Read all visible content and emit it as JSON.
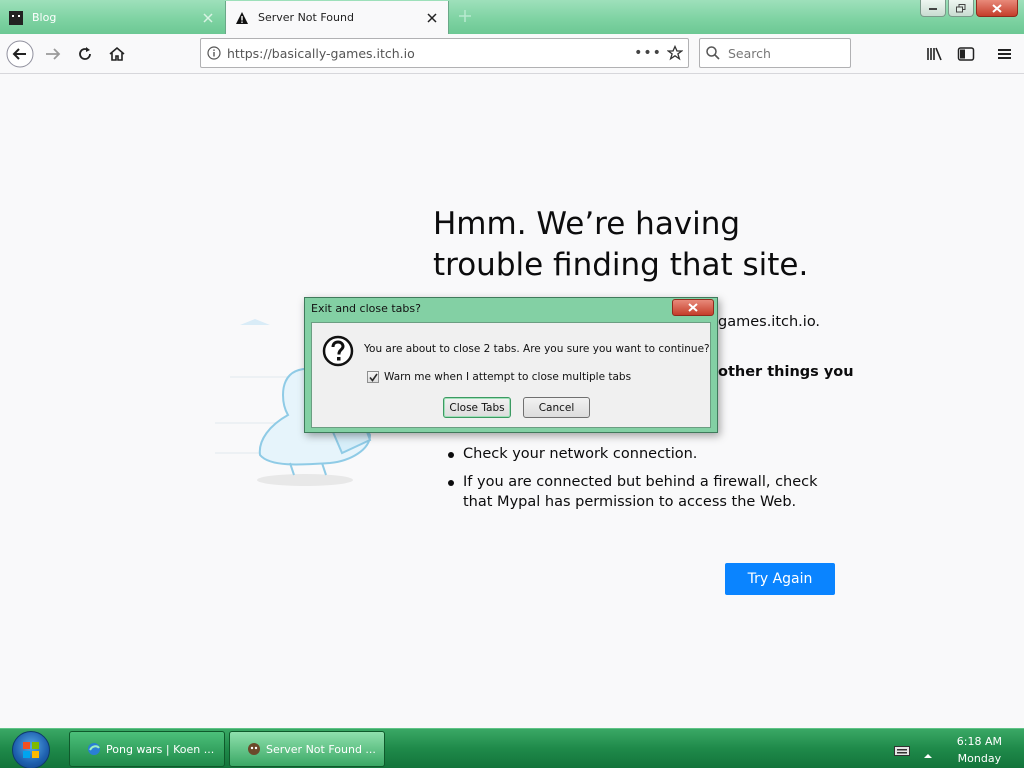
{
  "browser": {
    "tabs": [
      {
        "title": "Blog",
        "active": false
      },
      {
        "title": "Server Not Found",
        "active": true
      }
    ],
    "url": "https://basically-games.itch.io",
    "search_placeholder": "Search",
    "url_more": "•••"
  },
  "error_page": {
    "title": "Hmm. We’re having trouble finding that site.",
    "partial_host": "games.itch.io.",
    "partial_heading": "other things you",
    "bullets": [
      "Check your network connection.",
      "If you are connected but behind a firewall, check that Mypal has permission to access the Web."
    ],
    "try_again": "Try Again"
  },
  "dialog": {
    "title": "Exit and close tabs?",
    "message": "You are about to close 2 tabs. Are you sure you want to continue?",
    "checkbox_label": "Warn me when I attempt to close multiple tabs",
    "checkbox_checked": true,
    "confirm_label": "Close Tabs",
    "cancel_label": "Cancel"
  },
  "taskbar": {
    "items": [
      {
        "label": "Pong wars | Koen ...",
        "active": false
      },
      {
        "label": "Server Not Found ...",
        "active": true
      }
    ],
    "time": "6:18 AM",
    "day": "Monday"
  },
  "colors": {
    "accent": "#0a84ff",
    "chrome": "#83d0a4",
    "taskbar": "#1f8a4a"
  }
}
